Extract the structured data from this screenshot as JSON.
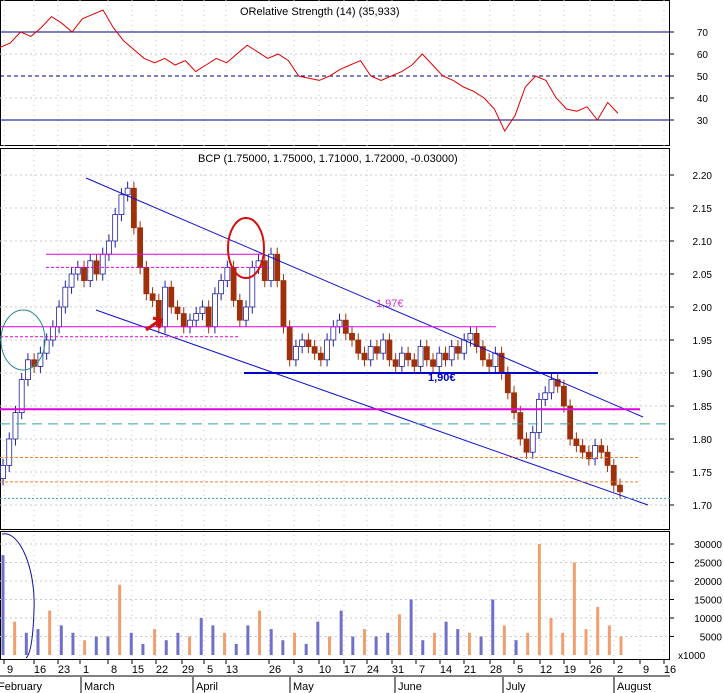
{
  "colors": {
    "background": "#ffffff",
    "grid": "#c9c9c9",
    "panel_border": "#000000",
    "rsi_line": "#e00000",
    "rsi_levels": "#000080",
    "channel": "#1010d0",
    "support": "#0000cc",
    "magenta_line": "#dd00dd",
    "teal_dash": "#3aa0a8",
    "orange_dash": "#f08030",
    "down_candle": "#a0300a",
    "up_candle": "#ffffff",
    "volume_blue": "#7070c8",
    "volume_orange": "#f0a070",
    "annot_red": "#d01010",
    "annot_teal": "#2a8a8a"
  },
  "rsi_panel": {
    "title": "ORelative Strength (14) (35,933)",
    "ticks": [
      "70",
      "60",
      "50",
      "40",
      "30"
    ]
  },
  "price_panel": {
    "title": "BCP (1.75000, 1.75000, 1.71000, 1.72000, -0.03000)",
    "ticks": [
      "2.20",
      "2.15",
      "2.10",
      "2.05",
      "2.00",
      "1.95",
      "1.90",
      "1.85",
      "1.80",
      "1.75",
      "1.70"
    ],
    "annotations": {
      "label_197": "1,97€",
      "label_190": "1,90€"
    }
  },
  "volume_panel": {
    "ticks": [
      "30000",
      "25000",
      "20000",
      "15000",
      "10000",
      "5000"
    ],
    "multiplier": "x1000"
  },
  "x_axis": {
    "days": [
      "9",
      "16",
      "23",
      "1",
      "8",
      "15",
      "22",
      "29",
      "5",
      "13",
      "26",
      "3",
      "10",
      "17",
      "24",
      "31",
      "7",
      "14",
      "21",
      "28",
      "5",
      "12",
      "19",
      "26",
      "2",
      "9",
      "16"
    ],
    "months": [
      "February",
      "March",
      "April",
      "May",
      "June",
      "July",
      "August"
    ]
  },
  "chart_data": {
    "type": "candlestick",
    "title": "BCP (1.75000, 1.75000, 1.71000, 1.72000, -0.03000)",
    "ylim": [
      1.68,
      2.22
    ],
    "series_close": [
      1.76,
      1.8,
      1.84,
      1.89,
      1.92,
      1.91,
      1.93,
      1.95,
      1.97,
      2.0,
      2.03,
      2.05,
      2.06,
      2.04,
      2.07,
      2.05,
      2.08,
      2.1,
      2.14,
      2.17,
      2.18,
      2.12,
      2.06,
      2.02,
      2.01,
      1.97,
      2.03,
      2.0,
      1.99,
      1.97,
      1.98,
      1.99,
      2.0,
      1.97,
      2.02,
      2.04,
      2.06,
      2.01,
      1.98,
      2.0,
      2.06,
      2.07,
      2.04,
      2.08,
      2.04,
      1.97,
      1.92,
      1.94,
      1.95,
      1.94,
      1.93,
      1.92,
      1.95,
      1.97,
      1.98,
      1.96,
      1.95,
      1.93,
      1.92,
      1.94,
      1.93,
      1.95,
      1.92,
      1.91,
      1.93,
      1.92,
      1.91,
      1.94,
      1.92,
      1.91,
      1.93,
      1.92,
      1.94,
      1.93,
      1.95,
      1.96,
      1.94,
      1.92,
      1.91,
      1.93,
      1.9,
      1.87,
      1.84,
      1.8,
      1.78,
      1.81,
      1.86,
      1.87,
      1.89,
      1.88,
      1.85,
      1.8,
      1.79,
      1.78,
      1.77,
      1.79,
      1.78,
      1.76,
      1.73,
      1.72
    ],
    "rsi_values": [
      63,
      65,
      70,
      68,
      72,
      77,
      74,
      70,
      76,
      78,
      80,
      72,
      66,
      62,
      58,
      56,
      58,
      55,
      57,
      52,
      55,
      58,
      56,
      60,
      64,
      61,
      58,
      60,
      57,
      50,
      49,
      48,
      50,
      53,
      55,
      57,
      50,
      48,
      50,
      52,
      55,
      60,
      55,
      50,
      48,
      45,
      43,
      40,
      35,
      25,
      32,
      45,
      50,
      48,
      40,
      35,
      34,
      36,
      30,
      38,
      33
    ],
    "volume_values": [
      27,
      9,
      6,
      7,
      12,
      8,
      6,
      4,
      5,
      5,
      19,
      6,
      3,
      7,
      4,
      6,
      5,
      10,
      8,
      6,
      3,
      8,
      12,
      7,
      4,
      6,
      3,
      9,
      5,
      12,
      5,
      7,
      5,
      6,
      11,
      15,
      4,
      6,
      9,
      7,
      6,
      5,
      15,
      8,
      4,
      6,
      30,
      10,
      6,
      25,
      7,
      13,
      8,
      5
    ],
    "levels": {
      "support": 1.9,
      "resistance_label": 1.97,
      "magenta_lower": 1.845,
      "teal_dash": 1.823
    }
  }
}
